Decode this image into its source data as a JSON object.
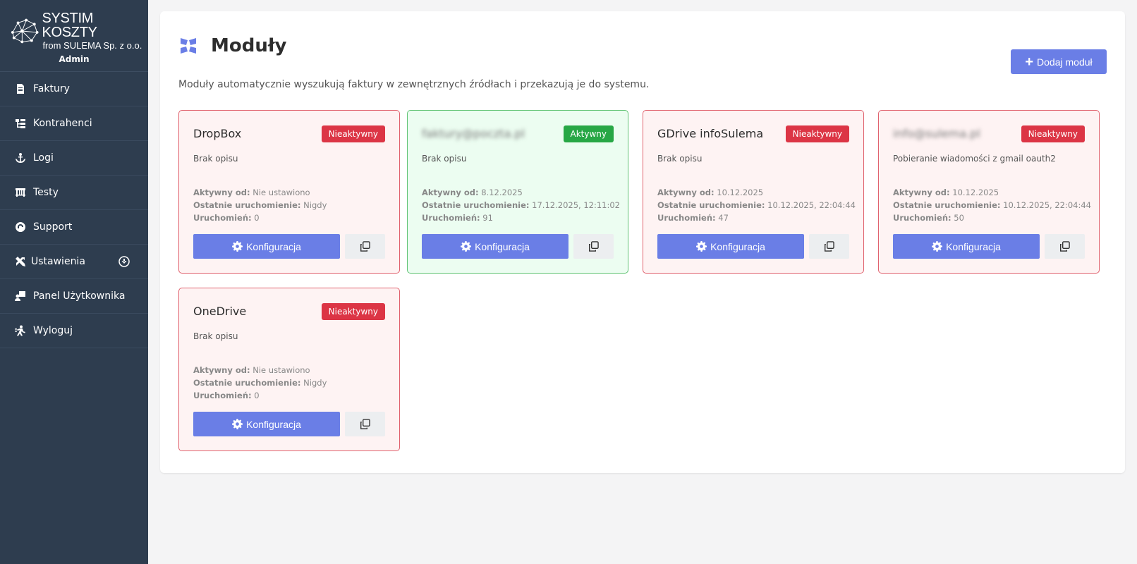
{
  "brand": {
    "title": "SYSTIM KOSZTY",
    "subtitle": "from SULEMA Sp. z o.o.",
    "user": "Admin"
  },
  "sidebar": {
    "items": [
      {
        "label": "Faktury",
        "icon": "document-icon"
      },
      {
        "label": "Kontrahenci",
        "icon": "tree-icon"
      },
      {
        "label": "Logi",
        "icon": "anchor-icon"
      },
      {
        "label": "Testy",
        "icon": "bridge-icon"
      },
      {
        "label": "Support",
        "icon": "headset-icon"
      },
      {
        "label": "Ustawienia",
        "icon": "tools-icon"
      },
      {
        "label": "Panel Użytkownika",
        "icon": "user-panel-icon"
      },
      {
        "label": "Wyloguj",
        "icon": "logout-icon"
      }
    ]
  },
  "page": {
    "title": "Moduły",
    "description": "Moduły automatycznie wyszukują faktury w zewnętrznych źródłach i przekazują je do systemu.",
    "add_button": "Dodaj moduł"
  },
  "labels": {
    "active_since": "Aktywny od:",
    "last_run": "Ostatnie uruchomienie:",
    "runs": "Uruchomień:",
    "configure": "Konfiguracja"
  },
  "modules": [
    {
      "name": "DropBox",
      "status": "Nieaktywny",
      "description": "Brak opisu",
      "active_since": "Nie ustawiono",
      "last_run": "Nigdy",
      "runs": "0"
    },
    {
      "name": "faktury@poczta.pl",
      "status": "Aktywny",
      "description": "Brak opisu",
      "active_since": "8.12.2025",
      "last_run": "17.12.2025, 12:11:02",
      "runs": "91"
    },
    {
      "name": "GDrive infoSulema",
      "status": "Nieaktywny",
      "description": "Brak opisu",
      "active_since": "10.12.2025",
      "last_run": "10.12.2025, 22:04:44",
      "runs": "47"
    },
    {
      "name": "info@sulema.pl",
      "status": "Nieaktywny",
      "description": "Pobieranie wiadomości z gmail oauth2",
      "active_since": "10.12.2025",
      "last_run": "10.12.2025, 22:04:44",
      "runs": "50"
    },
    {
      "name": "OneDrive",
      "status": "Nieaktywny",
      "description": "Brak opisu",
      "active_since": "Nie ustawiono",
      "last_run": "Nigdy",
      "runs": "0"
    }
  ],
  "colors": {
    "sidebar_bg": "#2e3d4f",
    "accent": "#6a7ee6",
    "inactive": "#dc3545",
    "active": "#27a745"
  }
}
